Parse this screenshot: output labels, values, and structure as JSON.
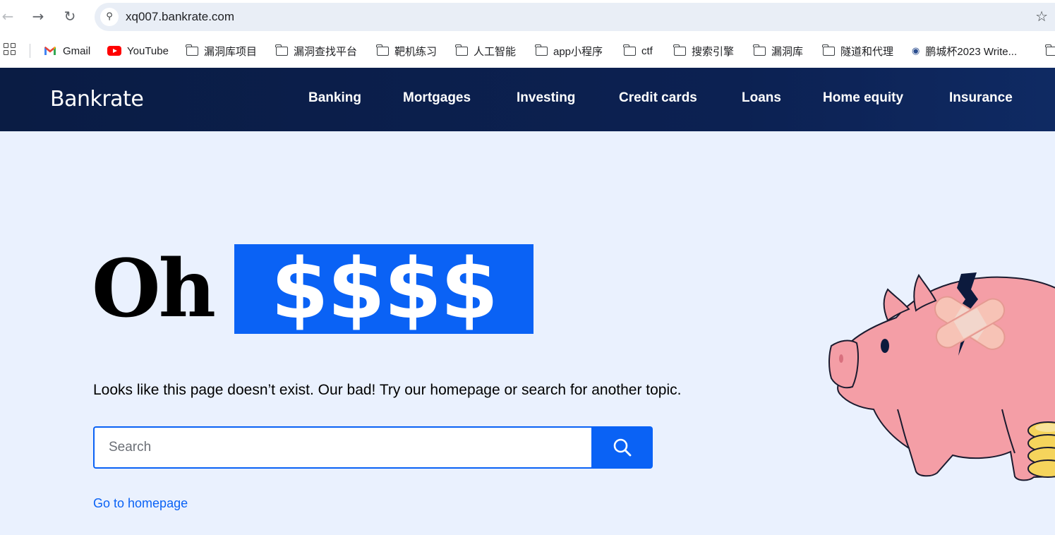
{
  "browser": {
    "url": "xq007.bankrate.com",
    "back_glyph": "←",
    "forward_glyph": "→",
    "reload_glyph": "↻",
    "site_info_glyph": "⚲",
    "star_glyph": "☆"
  },
  "bookmarks": [
    {
      "label": "Gmail",
      "icon": "gmail-icon"
    },
    {
      "label": "YouTube",
      "icon": "youtube-icon"
    },
    {
      "label": "漏洞库项目",
      "icon": "folder-icon"
    },
    {
      "label": "漏洞查找平台",
      "icon": "folder-icon"
    },
    {
      "label": "靶机练习",
      "icon": "folder-icon"
    },
    {
      "label": "人工智能",
      "icon": "folder-icon"
    },
    {
      "label": "app小程序",
      "icon": "folder-icon"
    },
    {
      "label": "ctf",
      "icon": "folder-icon"
    },
    {
      "label": "搜索引擎",
      "icon": "folder-icon"
    },
    {
      "label": "漏洞库",
      "icon": "folder-icon"
    },
    {
      "label": "隧道和代理",
      "icon": "folder-icon"
    },
    {
      "label": "鹏城杯2023 Write...",
      "icon": "site-favicon-icon"
    }
  ],
  "site": {
    "logo": "Bankrate",
    "nav": [
      "Banking",
      "Mortgages",
      "Investing",
      "Credit cards",
      "Loans",
      "Home equity",
      "Insurance"
    ]
  },
  "error": {
    "headline_word": "Oh",
    "headline_highlight": "$$$$",
    "message": "Looks like this page doesn’t exist. Our bad! Try our homepage or search for another topic.",
    "search_placeholder": "Search",
    "home_link": "Go to homepage"
  },
  "colors": {
    "brand_blue": "#0a62f5",
    "header_navy": "#0a1c44",
    "page_background": "#eaf1fe",
    "piggy_pink": "#f49ea6"
  }
}
